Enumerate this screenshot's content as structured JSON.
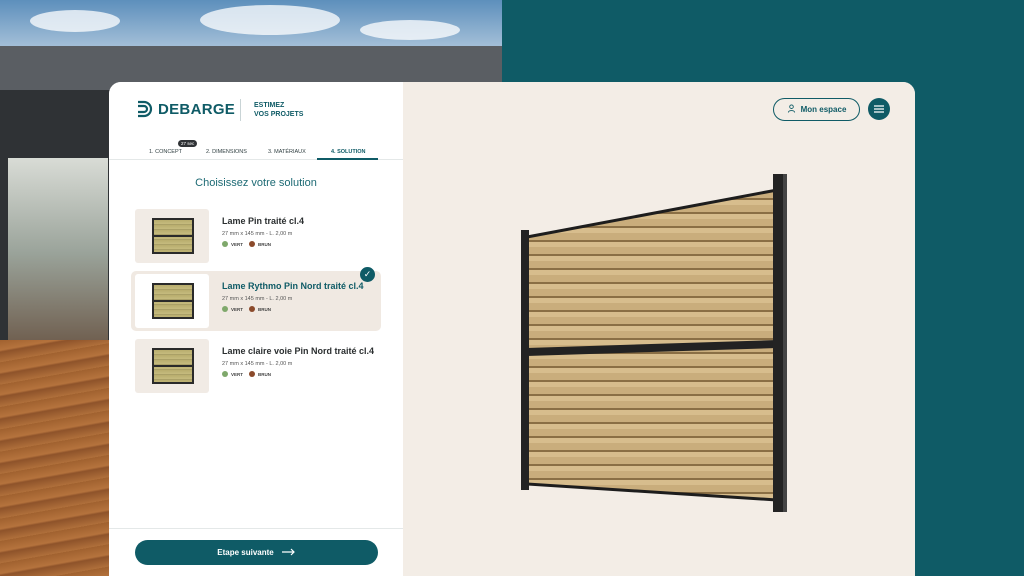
{
  "brand": {
    "name": "DEBARGE",
    "tagline_line1": "ESTIMEZ",
    "tagline_line2": "VOS PROJETS",
    "primary_color": "#0f5b66"
  },
  "steps": [
    {
      "label": "1. CONCEPT",
      "badge": "27 sec"
    },
    {
      "label": "2. DIMENSIONS"
    },
    {
      "label": "3. MATÉRIAUX"
    },
    {
      "label": "4. SOLUTION",
      "active": true
    }
  ],
  "main": {
    "title": "Choisissez votre solution",
    "options": [
      {
        "name": "Lame Pin traité cl.4",
        "dims": "27 mm x 145 mm - L. 2,00 m",
        "colors": [
          {
            "label": "VERT",
            "hex": "#7fa86b"
          },
          {
            "label": "BRUN",
            "hex": "#8b4a2b"
          }
        ],
        "selected": false
      },
      {
        "name": "Lame Rythmo Pin Nord traité cl.4",
        "dims": "27 mm x 145 mm - L. 2,00 m",
        "colors": [
          {
            "label": "VERT",
            "hex": "#7fa86b"
          },
          {
            "label": "BRUN",
            "hex": "#8b4a2b"
          }
        ],
        "selected": true
      },
      {
        "name": "Lame claire voie Pin Nord traité cl.4",
        "dims": "27 mm x 145 mm - L. 2,00 m",
        "colors": [
          {
            "label": "VERT",
            "hex": "#7fa86b"
          },
          {
            "label": "BRUN",
            "hex": "#8b4a2b"
          }
        ],
        "selected": false
      }
    ],
    "next_label": "Etape suivante"
  },
  "header": {
    "account_label": "Mon espace"
  },
  "icons": {
    "user": "user-icon",
    "menu": "hamburger-icon",
    "arrow": "arrow-right-icon",
    "check": "check-icon"
  }
}
